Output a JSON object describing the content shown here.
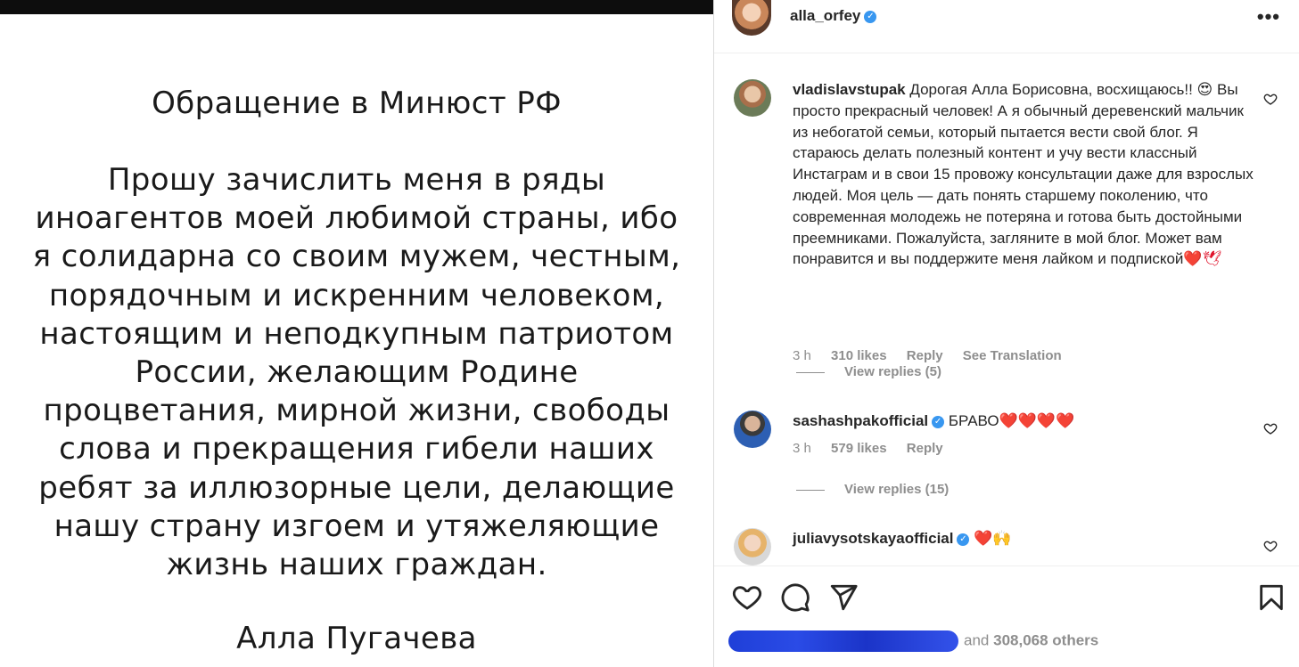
{
  "post": {
    "title": "Обращение в Минюст РФ",
    "body": "Прошу зачислить меня в ряды иноагентов моей любимой страны, ибо я солидарна со своим мужем, честным, порядочным и искренним человеком, настоящим и неподкупным патриотом России, желающим Родине процветания, мирной жизни, свободы слова и прекращения гибели наших ребят за иллюзорные цели, делающие нашу страну изгоем и утяжеляющие жизнь наших граждан.",
    "signature": "Алла Пугачева"
  },
  "header": {
    "username": "alla_orfey",
    "verified_icon": "verified-badge-icon",
    "more_icon": "•••"
  },
  "comments": [
    {
      "username": "vladislavstupak",
      "text": "Дорогая Алла Борисовна, восхищаюсь!! 😍 Вы просто прекрасный человек! А я обычный деревенский мальчик из небогатой семьи, который пытается вести свой блог. Я стараюсь делать полезный контент и учу вести классный Инстаграм и в свои 15 провожу консультации даже для взрослых людей. Моя цель — дать понять старшему поколению, что современная молодежь не потеряна и готова быть достойными преемниками. Пожалуйста, загляните в мой блог. Может вам понравится и вы поддержите меня лайком и подпиской",
      "emoji": "❤️🕊",
      "time": "3 h",
      "likes": "310 likes",
      "reply": "Reply",
      "translate": "See Translation",
      "view_replies": "View replies (5)"
    },
    {
      "username": "sashashpakofficial",
      "text": "БРАВО",
      "emoji": "❤️❤️❤️❤️",
      "time": "3 h",
      "likes": "579 likes",
      "reply": "Reply",
      "view_replies": "View replies (15)"
    },
    {
      "username": "juliavysotskayaofficial",
      "text": "",
      "emoji": "❤️🙌"
    }
  ],
  "actions": {
    "likes_prefix": "and",
    "likes_count": "308,068 others"
  },
  "colors": {
    "accent_blue": "#3897f0",
    "meta_grey": "#8e8e8e",
    "text": "#262626"
  }
}
